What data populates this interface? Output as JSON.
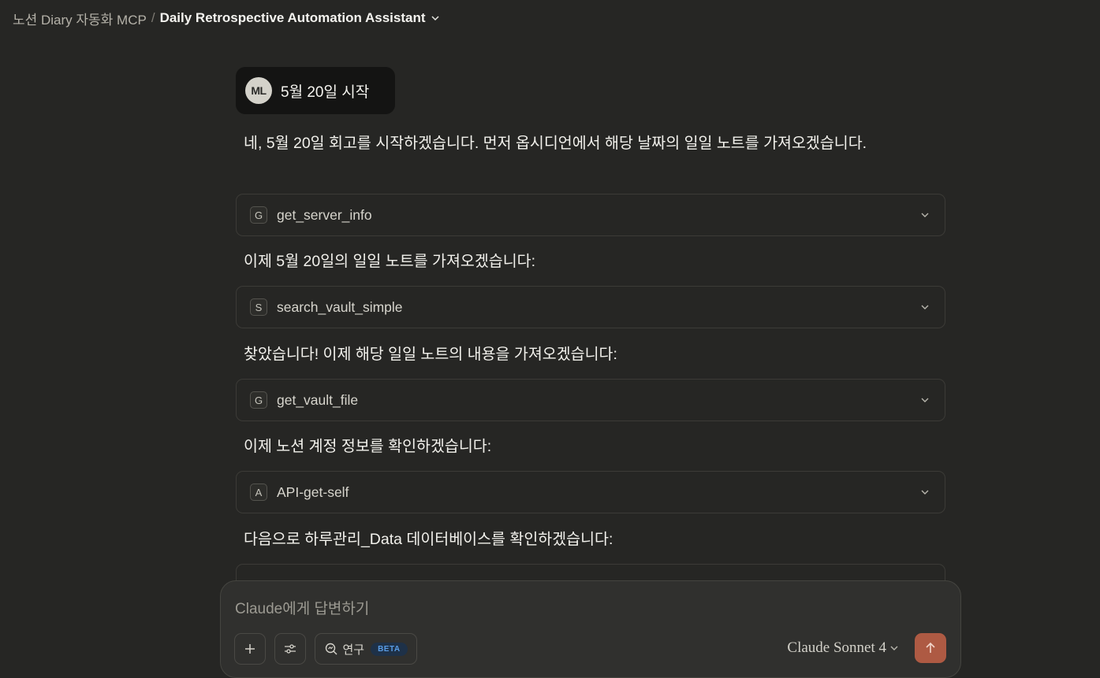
{
  "breadcrumb": {
    "project": "노션 Diary 자동화 MCP",
    "separator": "/",
    "title": "Daily Retrospective Automation Assistant"
  },
  "user_message": {
    "avatar_initials": "ML",
    "text": "5월 20일 시작"
  },
  "assistant": {
    "intro": "네, 5월 20일 회고를 시작하겠습니다. 먼저 옵시디언에서 해당 날짜의 일일 노트를 가져오겠습니다.",
    "step1_text": "이제 5월 20일의 일일 노트를 가져오겠습니다:",
    "step2_text": "찾았습니다! 이제 해당 일일 노트의 내용을 가져오겠습니다:",
    "step3_text": "이제 노션 계정 정보를 확인하겠습니다:",
    "step4_text": "다음으로 하루관리_Data 데이터베이스를 확인하겠습니다:"
  },
  "tools": [
    {
      "badge": "G",
      "name": "get_server_info"
    },
    {
      "badge": "S",
      "name": "search_vault_simple"
    },
    {
      "badge": "G",
      "name": "get_vault_file"
    },
    {
      "badge": "A",
      "name": "API-get-self"
    }
  ],
  "composer": {
    "placeholder": "Claude에게 답변하기",
    "research_label": "연구",
    "beta_badge": "BETA",
    "model_name": "Claude Sonnet 4"
  },
  "colors": {
    "background": "#262624",
    "send_button": "#ae5a43",
    "beta_text": "#5a9de6"
  },
  "icons": [
    "chevron-down-icon",
    "plus-icon",
    "sliders-icon",
    "research-icon",
    "arrow-up-icon"
  ]
}
